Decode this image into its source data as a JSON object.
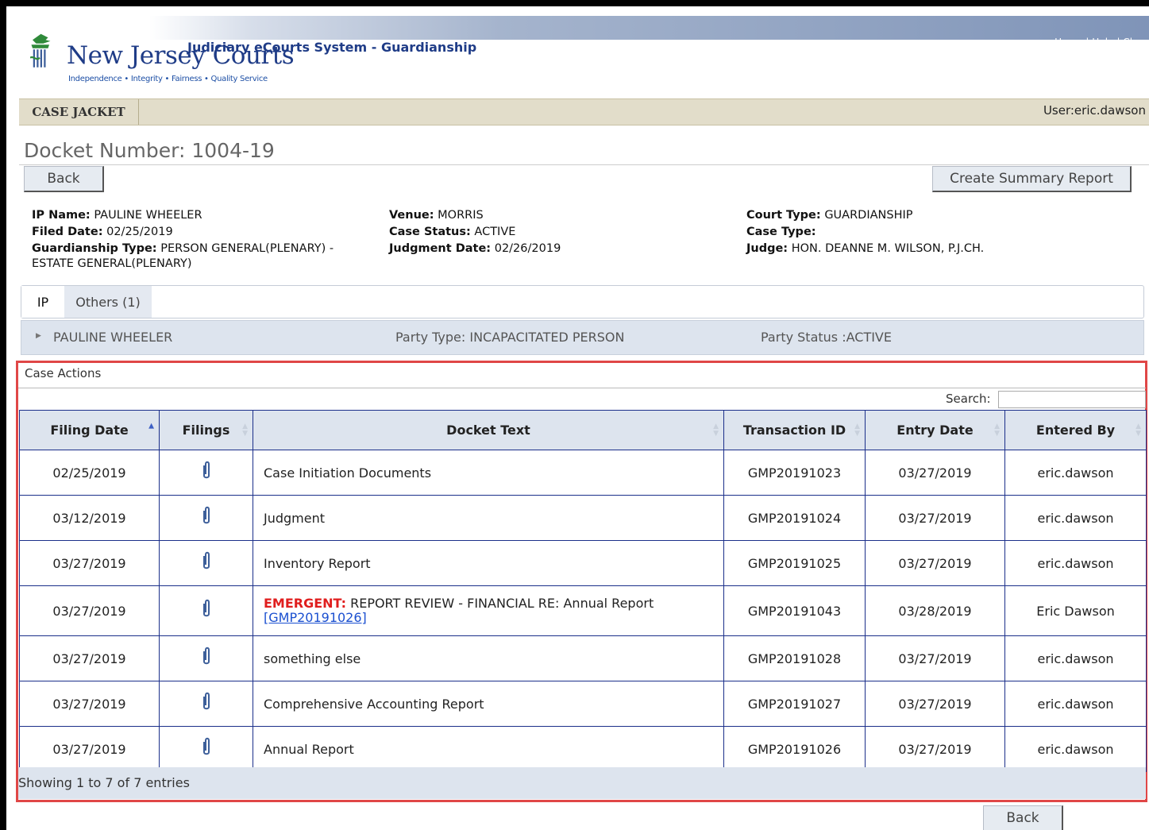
{
  "header": {
    "logo_text": "New Jersey Courts",
    "logo_tagline": "Independence • Integrity • Fairness • Quality Service",
    "system_title": "Judiciary eCourts System - Guardianship",
    "links": "Home  |  Help  |  Close"
  },
  "nav": {
    "tab_label": "CASE JACKET",
    "user": "User:eric.dawson"
  },
  "docket": {
    "label": "Docket Number:",
    "number": "1004-19"
  },
  "buttons": {
    "back": "Back",
    "create_summary": "Create Summary Report",
    "back_bottom": "Back"
  },
  "case_info": {
    "ip_name_label": "IP Name:",
    "ip_name": "PAULINE WHEELER",
    "filed_date_label": "Filed Date:",
    "filed_date": "02/25/2019",
    "guardianship_type_label": "Guardianship Type:",
    "guardianship_type": "PERSON GENERAL(PLENARY) -",
    "guardianship_type_cont": "ESTATE GENERAL(PLENARY)",
    "venue_label": "Venue:",
    "venue": "MORRIS",
    "case_status_label": "Case Status:",
    "case_status": "ACTIVE",
    "judgment_date_label": "Judgment Date:",
    "judgment_date": "02/26/2019",
    "court_type_label": "Court Type:",
    "court_type": "GUARDIANSHIP",
    "case_type_label": "Case Type:",
    "case_type": "",
    "judge_label": "Judge:",
    "judge": "HON. DEANNE M. WILSON, P.J.CH."
  },
  "party_tabs": [
    {
      "label": "IP"
    },
    {
      "label": "Others (1)"
    }
  ],
  "party": {
    "name": "PAULINE WHEELER",
    "type": "Party Type: INCAPACITATED PERSON",
    "status": "Party Status :ACTIVE"
  },
  "case_actions": {
    "title": "Case Actions",
    "search_label": "Search:",
    "search_value": "",
    "columns": [
      "Filing Date",
      "Filings",
      "Docket Text",
      "Transaction ID",
      "Entry Date",
      "Entered By"
    ],
    "rows": [
      {
        "filing_date": "02/25/2019",
        "docket_text": "Case Initiation Documents",
        "transaction_id": "GMP20191023",
        "entry_date": "03/27/2019",
        "entered_by": "eric.dawson"
      },
      {
        "filing_date": "03/12/2019",
        "docket_text": "Judgment",
        "transaction_id": "GMP20191024",
        "entry_date": "03/27/2019",
        "entered_by": "eric.dawson"
      },
      {
        "filing_date": "03/27/2019",
        "docket_text": "Inventory Report",
        "transaction_id": "GMP20191025",
        "entry_date": "03/27/2019",
        "entered_by": "eric.dawson"
      },
      {
        "filing_date": "03/27/2019",
        "emergent": "EMERGENT:",
        "docket_text": " REPORT REVIEW - FINANCIAL RE: Annual Report",
        "link": "[GMP20191026]",
        "transaction_id": "GMP20191043",
        "entry_date": "03/28/2019",
        "entered_by": "Eric Dawson"
      },
      {
        "filing_date": "03/27/2019",
        "docket_text": "something else",
        "transaction_id": "GMP20191028",
        "entry_date": "03/27/2019",
        "entered_by": "eric.dawson"
      },
      {
        "filing_date": "03/27/2019",
        "docket_text": "Comprehensive Accounting Report",
        "transaction_id": "GMP20191027",
        "entry_date": "03/27/2019",
        "entered_by": "eric.dawson"
      },
      {
        "filing_date": "03/27/2019",
        "docket_text": "Annual Report",
        "transaction_id": "GMP20191026",
        "entry_date": "03/27/2019",
        "entered_by": "eric.dawson"
      }
    ],
    "footer": "Showing 1 to 7 of 7 entries"
  }
}
